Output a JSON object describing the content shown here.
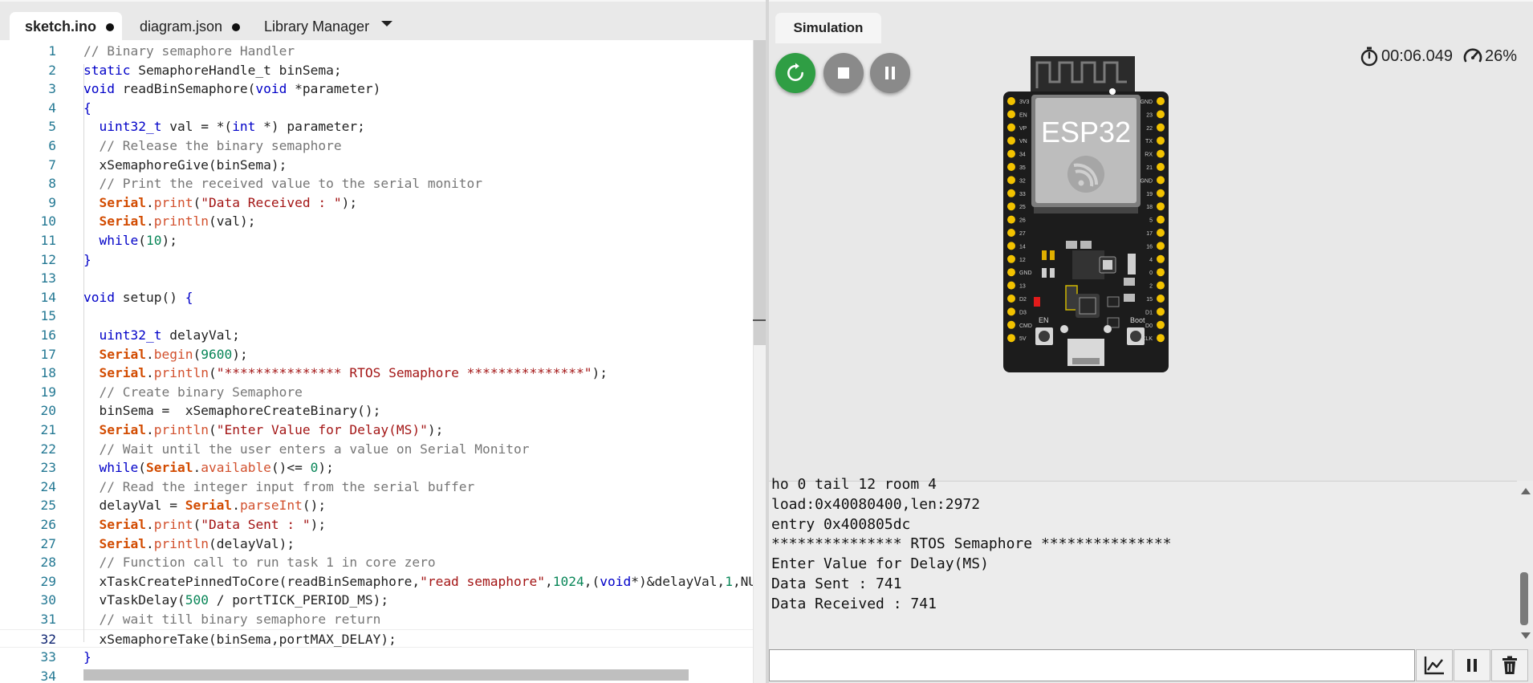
{
  "editor": {
    "tabs": [
      {
        "label": "sketch.ino",
        "modified": true,
        "active": true
      },
      {
        "label": "diagram.json",
        "modified": true,
        "active": false
      },
      {
        "label": "Library Manager",
        "modified": false,
        "active": false
      }
    ],
    "current_line": 32,
    "lines": [
      {
        "n": "1",
        "tokens": [
          [
            "comment",
            "// Binary semaphore Handler"
          ]
        ]
      },
      {
        "n": "2",
        "tokens": [
          [
            "keyword",
            "static "
          ],
          [
            "plain",
            "SemaphoreHandle_t binSema;"
          ]
        ]
      },
      {
        "n": "3",
        "tokens": [
          [
            "keyword",
            "void "
          ],
          [
            "plain",
            "readBinSemaphore("
          ],
          [
            "keyword",
            "void "
          ],
          [
            "plain",
            "*parameter)"
          ]
        ]
      },
      {
        "n": "4",
        "tokens": [
          [
            "keyword",
            "{"
          ]
        ]
      },
      {
        "n": "5",
        "tokens": [
          [
            "plain",
            "  "
          ],
          [
            "type",
            "uint32_t"
          ],
          [
            "plain",
            " val = *("
          ],
          [
            "keyword",
            "int"
          ],
          [
            "plain",
            " *) parameter;"
          ]
        ]
      },
      {
        "n": "6",
        "tokens": [
          [
            "plain",
            "  "
          ],
          [
            "comment",
            "// Release the binary semaphore"
          ]
        ]
      },
      {
        "n": "7",
        "tokens": [
          [
            "plain",
            "  xSemaphoreGive(binSema);"
          ]
        ]
      },
      {
        "n": "8",
        "tokens": [
          [
            "plain",
            "  "
          ],
          [
            "comment",
            "// Print the received value to the serial monitor"
          ]
        ]
      },
      {
        "n": "9",
        "tokens": [
          [
            "plain",
            "  "
          ],
          [
            "class",
            "Serial"
          ],
          [
            "plain",
            "."
          ],
          [
            "method",
            "print"
          ],
          [
            "plain",
            "("
          ],
          [
            "string",
            "\"Data Received : \""
          ],
          [
            "plain",
            ");"
          ]
        ]
      },
      {
        "n": "10",
        "tokens": [
          [
            "plain",
            "  "
          ],
          [
            "class",
            "Serial"
          ],
          [
            "plain",
            "."
          ],
          [
            "method",
            "println"
          ],
          [
            "plain",
            "(val);"
          ]
        ]
      },
      {
        "n": "11",
        "tokens": [
          [
            "plain",
            "  "
          ],
          [
            "keyword",
            "while"
          ],
          [
            "plain",
            "("
          ],
          [
            "number",
            "10"
          ],
          [
            "plain",
            ");"
          ]
        ]
      },
      {
        "n": "12",
        "tokens": [
          [
            "keyword",
            "}"
          ]
        ]
      },
      {
        "n": "13",
        "tokens": []
      },
      {
        "n": "14",
        "tokens": [
          [
            "keyword",
            "void "
          ],
          [
            "plain",
            "setup() "
          ],
          [
            "keyword",
            "{"
          ]
        ]
      },
      {
        "n": "15",
        "tokens": []
      },
      {
        "n": "16",
        "tokens": [
          [
            "plain",
            "  "
          ],
          [
            "type",
            "uint32_t"
          ],
          [
            "plain",
            " delayVal;"
          ]
        ]
      },
      {
        "n": "17",
        "tokens": [
          [
            "plain",
            "  "
          ],
          [
            "class",
            "Serial"
          ],
          [
            "plain",
            "."
          ],
          [
            "method",
            "begin"
          ],
          [
            "plain",
            "("
          ],
          [
            "number",
            "9600"
          ],
          [
            "plain",
            ");"
          ]
        ]
      },
      {
        "n": "18",
        "tokens": [
          [
            "plain",
            "  "
          ],
          [
            "class",
            "Serial"
          ],
          [
            "plain",
            "."
          ],
          [
            "method",
            "println"
          ],
          [
            "plain",
            "("
          ],
          [
            "string",
            "\"*************** RTOS Semaphore ***************\""
          ],
          [
            "plain",
            ");"
          ]
        ]
      },
      {
        "n": "19",
        "tokens": [
          [
            "plain",
            "  "
          ],
          [
            "comment",
            "// Create binary Semaphore"
          ]
        ]
      },
      {
        "n": "20",
        "tokens": [
          [
            "plain",
            "  binSema =  xSemaphoreCreateBinary();"
          ]
        ]
      },
      {
        "n": "21",
        "tokens": [
          [
            "plain",
            "  "
          ],
          [
            "class",
            "Serial"
          ],
          [
            "plain",
            "."
          ],
          [
            "method",
            "println"
          ],
          [
            "plain",
            "("
          ],
          [
            "string",
            "\"Enter Value for Delay(MS)\""
          ],
          [
            "plain",
            ");"
          ]
        ]
      },
      {
        "n": "22",
        "tokens": [
          [
            "plain",
            "  "
          ],
          [
            "comment",
            "// Wait until the user enters a value on Serial Monitor"
          ]
        ]
      },
      {
        "n": "23",
        "tokens": [
          [
            "plain",
            "  "
          ],
          [
            "keyword",
            "while"
          ],
          [
            "plain",
            "("
          ],
          [
            "class",
            "Serial"
          ],
          [
            "plain",
            "."
          ],
          [
            "method",
            "available"
          ],
          [
            "plain",
            "()<= "
          ],
          [
            "number",
            "0"
          ],
          [
            "plain",
            ");"
          ]
        ]
      },
      {
        "n": "24",
        "tokens": [
          [
            "plain",
            "  "
          ],
          [
            "comment",
            "// Read the integer input from the serial buffer"
          ]
        ]
      },
      {
        "n": "25",
        "tokens": [
          [
            "plain",
            "  delayVal = "
          ],
          [
            "class",
            "Serial"
          ],
          [
            "plain",
            "."
          ],
          [
            "method",
            "parseInt"
          ],
          [
            "plain",
            "();"
          ]
        ]
      },
      {
        "n": "26",
        "tokens": [
          [
            "plain",
            "  "
          ],
          [
            "class",
            "Serial"
          ],
          [
            "plain",
            "."
          ],
          [
            "method",
            "print"
          ],
          [
            "plain",
            "("
          ],
          [
            "string",
            "\"Data Sent : \""
          ],
          [
            "plain",
            ");"
          ]
        ]
      },
      {
        "n": "27",
        "tokens": [
          [
            "plain",
            "  "
          ],
          [
            "class",
            "Serial"
          ],
          [
            "plain",
            "."
          ],
          [
            "method",
            "println"
          ],
          [
            "plain",
            "(delayVal);"
          ]
        ]
      },
      {
        "n": "28",
        "tokens": [
          [
            "plain",
            "  "
          ],
          [
            "comment",
            "// Function call to run task 1 in core zero"
          ]
        ]
      },
      {
        "n": "29",
        "tokens": [
          [
            "plain",
            "  xTaskCreatePinnedToCore(readBinSemaphore,"
          ],
          [
            "string",
            "\"read semaphore\""
          ],
          [
            "plain",
            ","
          ],
          [
            "number",
            "1024"
          ],
          [
            "plain",
            ",("
          ],
          [
            "keyword",
            "void"
          ],
          [
            "plain",
            "*)&delayVal,"
          ],
          [
            "number",
            "1"
          ],
          [
            "plain",
            ",NULL,"
          ]
        ]
      },
      {
        "n": "30",
        "tokens": [
          [
            "plain",
            "  vTaskDelay("
          ],
          [
            "number",
            "500"
          ],
          [
            "plain",
            " / portTICK_PERIOD_MS);"
          ]
        ]
      },
      {
        "n": "31",
        "tokens": [
          [
            "plain",
            "  "
          ],
          [
            "comment",
            "// wait till binary semaphore return"
          ]
        ]
      },
      {
        "n": "32",
        "tokens": [
          [
            "plain",
            "  xSemaphoreTake(binSema,portMAX_DELAY);"
          ]
        ]
      },
      {
        "n": "33",
        "tokens": [
          [
            "keyword",
            "}"
          ]
        ]
      },
      {
        "n": "34",
        "tokens": []
      }
    ]
  },
  "simulation": {
    "tab_label": "Simulation",
    "timer": "00:06.049",
    "speed": "26%",
    "board": {
      "chip_label": "ESP32",
      "en_label": "EN",
      "boot_label": "Boot",
      "pins_left": [
        "3V3",
        "EN",
        "VP",
        "VN",
        "34",
        "35",
        "32",
        "33",
        "25",
        "26",
        "27",
        "14",
        "12",
        "GND",
        "13",
        "D2",
        "D3",
        "CMD",
        "5V"
      ],
      "pins_right": [
        "GND",
        "23",
        "22",
        "TX",
        "RX",
        "21",
        "GND",
        "19",
        "18",
        "5",
        "17",
        "16",
        "4",
        "0",
        "2",
        "15",
        "D1",
        "D0",
        "CLK"
      ]
    },
    "colors": {
      "restart_button": "#2f9e44",
      "control_button": "#8a8a8a",
      "board_pcb": "#1c1c1c",
      "pin_gold": "#f2c200",
      "led_red": "#e21b1b"
    }
  },
  "serial_monitor": {
    "lines": [
      "ho 0 tail 12 room 4",
      "load:0x40080400,len:2972",
      "entry 0x400805dc",
      "*************** RTOS Semaphore ***************",
      "Enter Value for Delay(MS)",
      "Data Sent : 741",
      "Data Received : 741"
    ],
    "input_value": "",
    "buttons": [
      {
        "icon": "chart-icon"
      },
      {
        "icon": "pause-icon"
      },
      {
        "icon": "trash-icon"
      }
    ]
  }
}
